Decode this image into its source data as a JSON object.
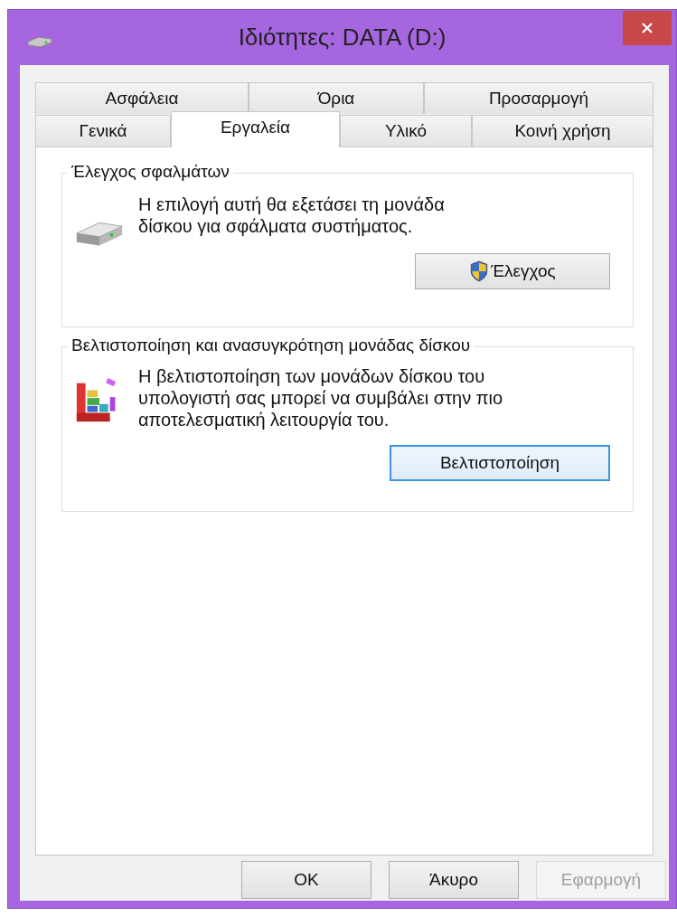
{
  "window": {
    "title": "Ιδιότητες: DATA (D:)"
  },
  "tab_rows": [
    {
      "tabs": [
        {
          "label": "Ασφάλεια",
          "selected": false
        },
        {
          "label": "Όρια",
          "selected": false
        },
        {
          "label": "Προσαρμογή",
          "selected": false
        }
      ]
    },
    {
      "tabs": [
        {
          "label": "Γενικά",
          "selected": false
        },
        {
          "label": "Εργαλεία",
          "selected": true
        },
        {
          "label": "Υλικό",
          "selected": false
        },
        {
          "label": "Κοινή χρήση",
          "selected": false
        }
      ]
    }
  ],
  "groups": [
    {
      "kind": "check",
      "title": "Έλεγχος σφαλμάτων",
      "text": "Η επιλογή αυτή θα εξετάσει τη μονάδα δίσκου για σφάλματα συστήματος.",
      "button": {
        "label": "Έλεγχος",
        "shield": true,
        "focused": false
      }
    },
    {
      "kind": "optimize",
      "title": "Βελτιστοποίηση και ανασυγκρότηση μονάδας δίσκου",
      "text": "Η βελτιστοποίηση των μονάδων δίσκου του υπολογιστή σας μπορεί να συμβάλει στην πιο αποτελεσματική λειτουργία του.",
      "button": {
        "label": "Βελτιστοποίηση",
        "shield": false,
        "focused": true
      }
    }
  ],
  "buttons": [
    {
      "label": "OK",
      "disabled": false
    },
    {
      "label": "Άκυρο",
      "disabled": false
    },
    {
      "label": "Εφαρμογή",
      "disabled": true
    }
  ]
}
